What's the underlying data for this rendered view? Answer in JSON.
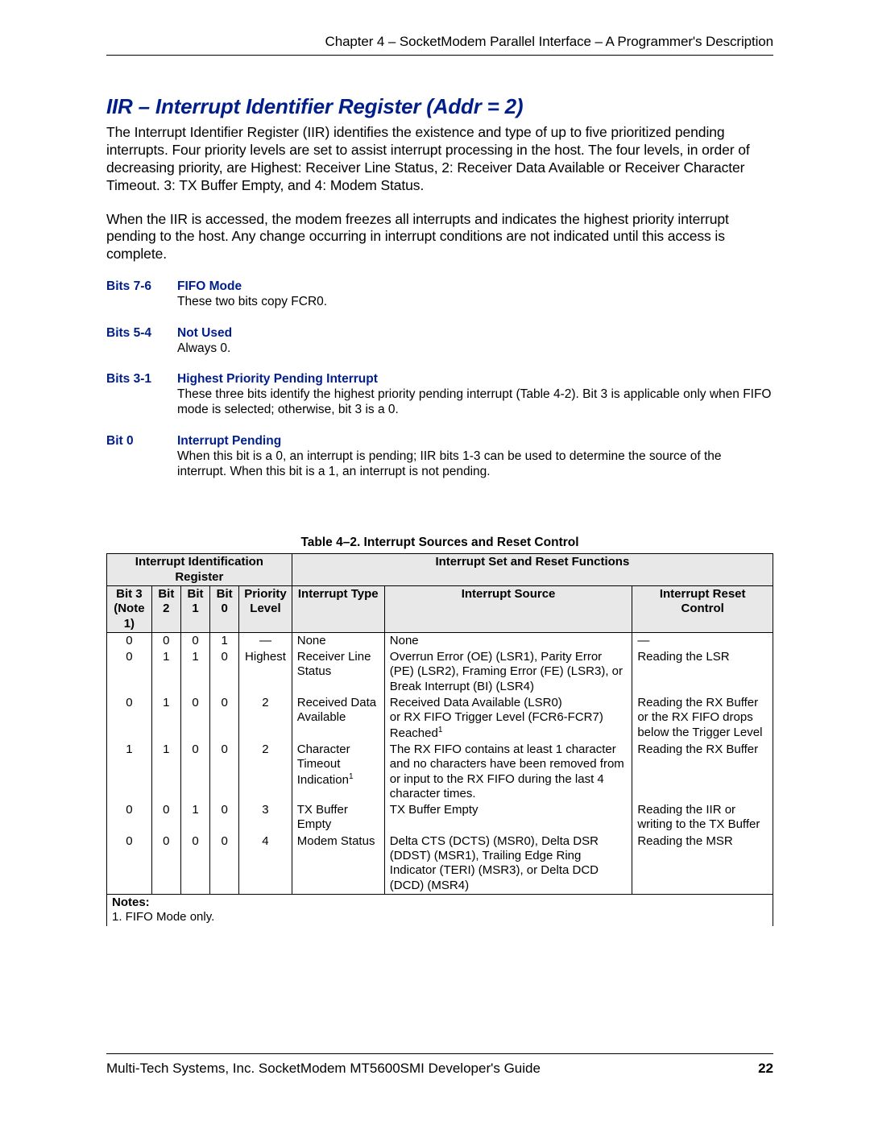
{
  "header": "Chapter 4 – SocketModem Parallel Interface – A Programmer's Description",
  "title": "IIR – Interrupt Identifier Register (Addr = 2)",
  "para1": "The Interrupt Identifier Register (IIR) identifies the existence and type of up to five prioritized pending interrupts. Four priority levels are set to assist interrupt processing in the host. The four levels, in order of decreasing priority, are Highest: Receiver Line Status, 2: Receiver Data Available or Receiver Character Timeout. 3: TX Buffer Empty, and 4: Modem Status.",
  "para2": "When the IIR is accessed, the modem freezes all interrupts and indicates the highest priority interrupt pending to the host. Any change occurring in interrupt conditions are not indicated until this access is complete.",
  "bits": [
    {
      "label": "Bits 7-6",
      "name": "FIFO Mode",
      "desc": "These two bits copy FCR0."
    },
    {
      "label": "Bits 5-4",
      "name": "Not Used",
      "desc": "Always 0."
    },
    {
      "label": "Bits 3-1",
      "name": "Highest Priority Pending Interrupt",
      "desc": "These three bits identify the highest priority pending interrupt (Table 4-2). Bit 3 is applicable only when FIFO mode is selected; otherwise, bit 3 is a 0."
    },
    {
      "label": "Bit 0",
      "name": "Interrupt Pending",
      "desc": "When this bit is a 0, an interrupt is pending; IIR bits 1-3 can be used to determine the source of the interrupt. When this bit is a 1, an interrupt is not pending."
    }
  ],
  "table_caption": "Table 4–2. Interrupt Sources and Reset Control",
  "thead": {
    "group1": "Interrupt Identification Register",
    "group2": "Interrupt Set and Reset Functions",
    "c1a": "Bit 3",
    "c1b": "(Note 1)",
    "c2": "Bit 2",
    "c3": "Bit 1",
    "c4": "Bit 0",
    "c5a": "Priority",
    "c5b": "Level",
    "c6": "Interrupt Type",
    "c7": "Interrupt Source",
    "c8a": "Interrupt Reset",
    "c8b": "Control"
  },
  "rows": [
    {
      "b3": "0",
      "b2": "0",
      "b1": "0",
      "b0": "1",
      "pl": "—",
      "type": "None",
      "src": "None",
      "rst": "—"
    },
    {
      "b3": "0",
      "b2": "1",
      "b1": "1",
      "b0": "0",
      "pl": "Highest",
      "type": "Receiver Line Status",
      "src": "Overrun Error (OE) (LSR1), Parity Error (PE) (LSR2), Framing Error (FE) (LSR3), or Break Interrupt (BI) (LSR4)",
      "rst": "Reading the LSR"
    },
    {
      "b3": "0",
      "b2": "1",
      "b1": "0",
      "b0": "0",
      "pl": "2",
      "type": "Received Data Available",
      "src": "Received Data Available (LSR0)\nor RX FIFO Trigger Level (FCR6-FCR7) Reached",
      "src_sup": "1",
      "rst": "Reading the RX Buffer or the RX FIFO drops below the Trigger Level"
    },
    {
      "b3": "1",
      "b2": "1",
      "b1": "0",
      "b0": "0",
      "pl": "2",
      "type": "Character Timeout Indication",
      "type_sup": "1",
      "src": "The RX FIFO contains at least 1 character and no characters have been removed from or input to the RX FIFO during the last 4 character times.",
      "rst": "Reading the RX Buffer"
    },
    {
      "b3": "0",
      "b2": "0",
      "b1": "1",
      "b0": "0",
      "pl": "3",
      "type": "TX Buffer Empty",
      "src": "TX Buffer Empty",
      "rst": "Reading the IIR or writing to the TX Buffer"
    },
    {
      "b3": "0",
      "b2": "0",
      "b1": "0",
      "b0": "0",
      "pl": "4",
      "type": "Modem Status",
      "src": "Delta CTS (DCTS) (MSR0), Delta DSR (DDST) (MSR1), Trailing Edge Ring Indicator (TERI) (MSR3), or Delta DCD (DCD) (MSR4)",
      "rst": "Reading the MSR"
    }
  ],
  "notes_label": "Notes:",
  "notes_text": "1. FIFO Mode only.",
  "footer_left": "Multi-Tech Systems, Inc. SocketModem MT5600SMI Developer's Guide",
  "footer_right": "22"
}
